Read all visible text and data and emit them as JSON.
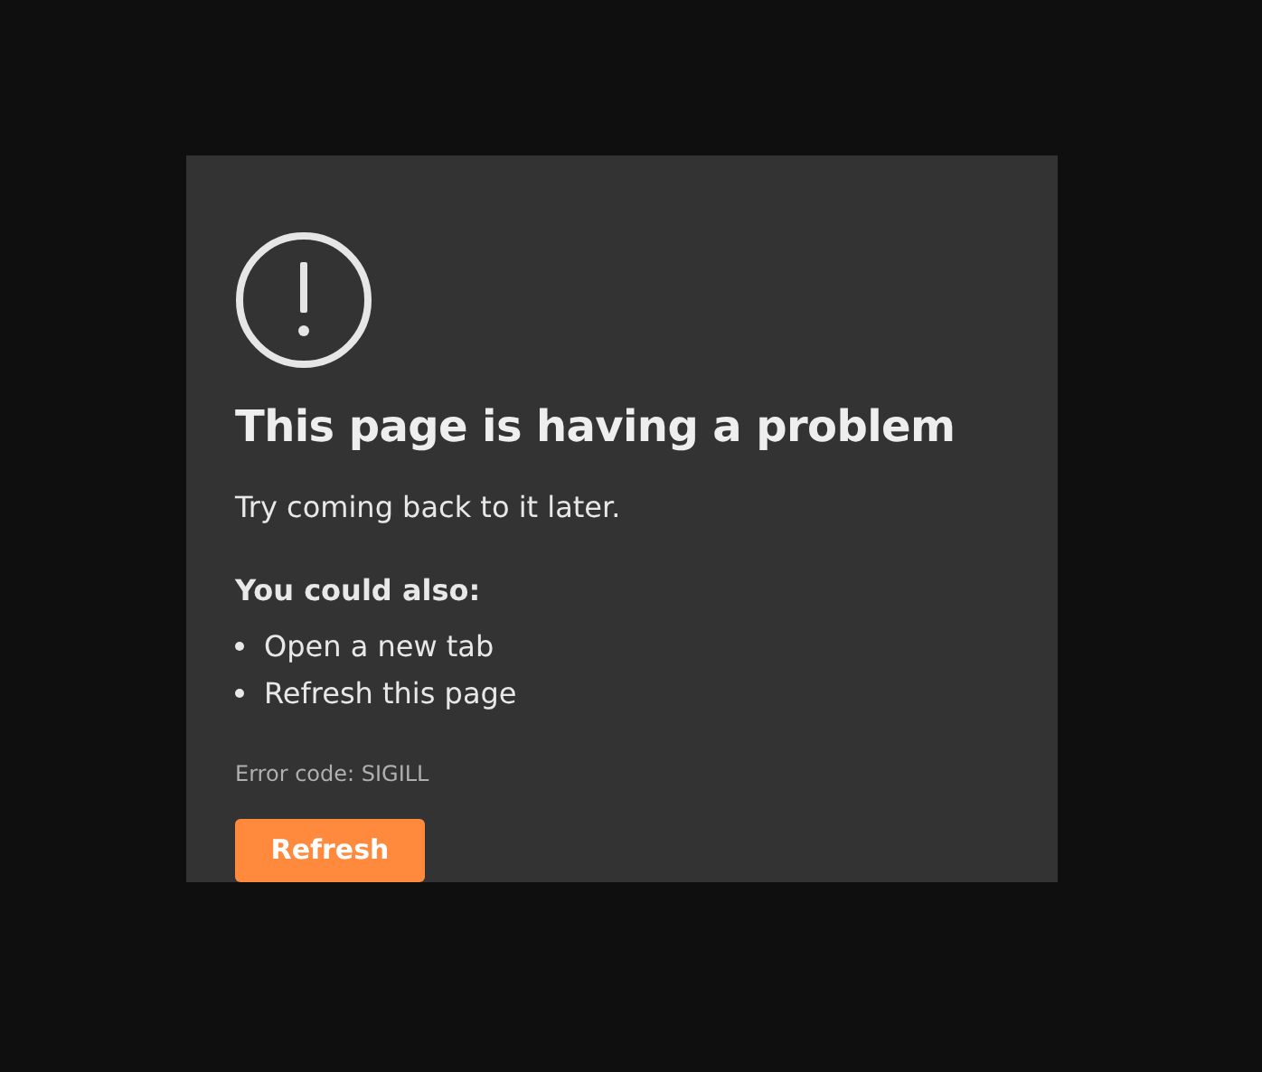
{
  "title": "This page is having a problem",
  "message": "Try coming back to it later.",
  "suggestions_heading": "You could also:",
  "suggestions": [
    "Open a new tab",
    "Refresh this page"
  ],
  "error_code": "Error code: SIGILL",
  "button": {
    "label": "Refresh"
  }
}
